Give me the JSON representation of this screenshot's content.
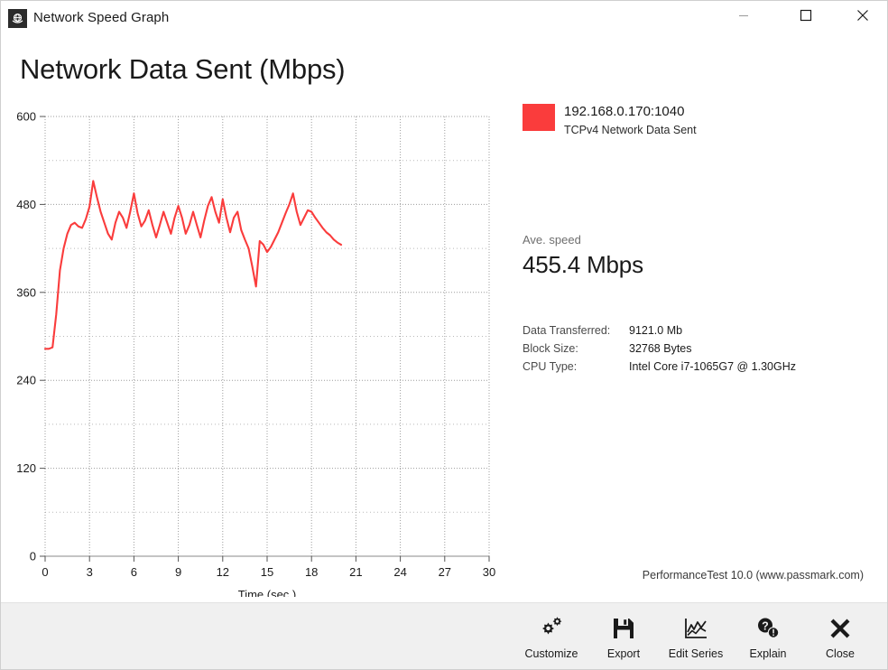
{
  "window": {
    "title": "Network Speed Graph",
    "icon": "app-network-icon",
    "controls": {
      "minimize": "minimize-icon",
      "maximize": "maximize-icon",
      "close": "close-icon"
    }
  },
  "heading": "Network Data Sent (Mbps)",
  "legend": {
    "color": "#fa3c3c",
    "title": "192.168.0.170:1040",
    "subtitle": "TCPv4 Network Data Sent"
  },
  "average": {
    "label": "Ave. speed",
    "value": "455.4 Mbps"
  },
  "stats": [
    {
      "key": "Data Transferred:",
      "value": "9121.0 Mb"
    },
    {
      "key": "Block Size:",
      "value": "32768 Bytes"
    },
    {
      "key": "CPU Type:",
      "value": "Intel Core i7-1065G7 @ 1.30GHz"
    }
  ],
  "footer": "PerformanceTest 10.0 (www.passmark.com)",
  "toolbar": [
    {
      "label": "Customize",
      "icon": "gears-icon"
    },
    {
      "label": "Export",
      "icon": "save-floppy-icon"
    },
    {
      "label": "Edit Series",
      "icon": "line-chart-icon"
    },
    {
      "label": "Explain",
      "icon": "question-help-icon"
    },
    {
      "label": "Close",
      "icon": "close-x-icon"
    }
  ],
  "chart_data": {
    "type": "line",
    "title": "Network Data Sent (Mbps)",
    "xlabel": "Time (sec.)",
    "ylabel": "",
    "xlim": [
      0,
      30
    ],
    "ylim": [
      0,
      600
    ],
    "xticks": [
      0,
      3,
      6,
      9,
      12,
      15,
      18,
      21,
      24,
      27,
      30
    ],
    "yticks": [
      0,
      120,
      240,
      360,
      480,
      600
    ],
    "minor_yticks": [
      60,
      180,
      300,
      420,
      540
    ],
    "grid": true,
    "grid_style": "dotted",
    "legend_position": "right",
    "series": [
      {
        "name": "192.168.0.170:1040",
        "label": "TCPv4 Network Data Sent",
        "color": "#fa3c3c",
        "x": [
          0.0,
          0.25,
          0.5,
          0.75,
          1.0,
          1.25,
          1.5,
          1.75,
          2.0,
          2.25,
          2.5,
          2.75,
          3.0,
          3.25,
          3.5,
          3.75,
          4.0,
          4.25,
          4.5,
          4.75,
          5.0,
          5.25,
          5.5,
          5.75,
          6.0,
          6.25,
          6.5,
          6.75,
          7.0,
          7.25,
          7.5,
          7.75,
          8.0,
          8.25,
          8.5,
          8.75,
          9.0,
          9.25,
          9.5,
          9.75,
          10.0,
          10.25,
          10.5,
          10.75,
          11.0,
          11.25,
          11.5,
          11.75,
          12.0,
          12.25,
          12.5,
          12.75,
          13.0,
          13.25,
          13.5,
          13.75,
          14.0,
          14.25,
          14.5,
          14.75,
          15.0,
          15.25,
          15.5,
          15.75,
          16.0,
          16.25,
          16.5,
          16.75,
          17.0,
          17.25,
          17.5,
          17.75,
          18.0,
          18.25,
          18.5,
          18.75,
          19.0,
          19.25,
          19.5,
          19.75,
          20.0
        ],
        "y": [
          283,
          283,
          285,
          330,
          390,
          420,
          440,
          452,
          455,
          450,
          448,
          460,
          477,
          512,
          490,
          470,
          455,
          440,
          432,
          455,
          470,
          462,
          448,
          470,
          495,
          468,
          450,
          458,
          472,
          452,
          435,
          452,
          470,
          455,
          440,
          462,
          478,
          462,
          440,
          452,
          470,
          452,
          435,
          458,
          478,
          490,
          470,
          455,
          487,
          462,
          442,
          462,
          470,
          445,
          432,
          420,
          395,
          368,
          430,
          425,
          415,
          422,
          432,
          442,
          455,
          468,
          480,
          495,
          470,
          452,
          462,
          472,
          470,
          462,
          455,
          448,
          442,
          438,
          432,
          428,
          425
        ]
      }
    ]
  }
}
